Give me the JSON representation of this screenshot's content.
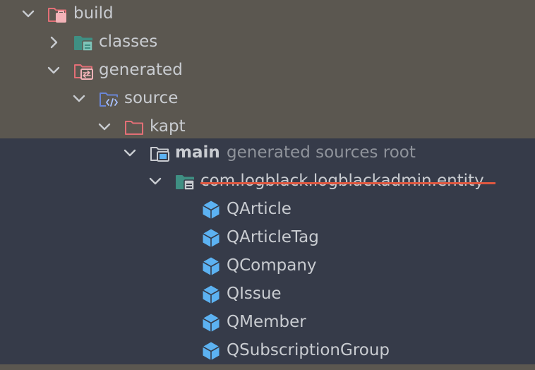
{
  "colors": {
    "excluded_background": "#5b5750",
    "generated_background": "#363b49",
    "strike": "#e05840",
    "class_icon": "#5cb2f2"
  },
  "tree": {
    "build": {
      "label": "build",
      "icon": "excluded-folder-icon"
    },
    "classes": {
      "label": "classes",
      "icon": "output-folder-icon"
    },
    "generated": {
      "label": "generated",
      "icon": "excluded-generated-folder-icon"
    },
    "source": {
      "label": "source",
      "icon": "source-folder-icon"
    },
    "kapt": {
      "label": "kapt",
      "icon": "excluded-folder-icon"
    },
    "main": {
      "label": "main",
      "hint": "generated sources root",
      "icon": "generated-root-icon"
    },
    "package": {
      "label": "com.logblack.logblackadmin.entity",
      "icon": "package-icon"
    },
    "classes_list": [
      {
        "label": "QArticle",
        "icon": "class-icon"
      },
      {
        "label": "QArticleTag",
        "icon": "class-icon"
      },
      {
        "label": "QCompany",
        "icon": "class-icon"
      },
      {
        "label": "QIssue",
        "icon": "class-icon"
      },
      {
        "label": "QMember",
        "icon": "class-icon"
      },
      {
        "label": "QSubscriptionGroup",
        "icon": "class-icon"
      }
    ]
  }
}
